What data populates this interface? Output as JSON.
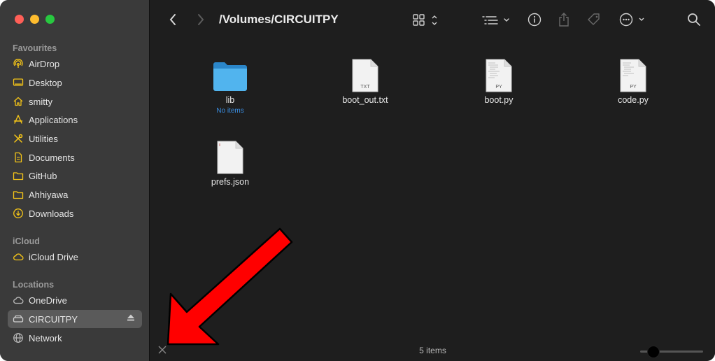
{
  "window": {
    "path_title": "/Volumes/CIRCUITPY"
  },
  "sidebar": {
    "favourites_heading": "Favourites",
    "favourites": [
      {
        "label": "AirDrop",
        "icon": "airdrop-icon"
      },
      {
        "label": "Desktop",
        "icon": "desktop-icon"
      },
      {
        "label": "smitty",
        "icon": "home-icon"
      },
      {
        "label": "Applications",
        "icon": "applications-icon"
      },
      {
        "label": "Utilities",
        "icon": "utilities-icon"
      },
      {
        "label": "Documents",
        "icon": "folder-icon"
      },
      {
        "label": "GitHub",
        "icon": "folder-icon"
      },
      {
        "label": "Ahhiyawa",
        "icon": "folder-icon"
      },
      {
        "label": "Downloads",
        "icon": "downloads-icon"
      }
    ],
    "icloud_heading": "iCloud",
    "icloud": [
      {
        "label": "iCloud Drive",
        "icon": "cloud-icon"
      }
    ],
    "locations_heading": "Locations",
    "locations": [
      {
        "label": "OneDrive",
        "icon": "cloud-icon"
      },
      {
        "label": "CIRCUITPY",
        "icon": "drive-icon",
        "selected": true
      },
      {
        "label": "Network",
        "icon": "network-icon"
      }
    ],
    "accent_color": "#f5c518"
  },
  "files": [
    {
      "name": "lib",
      "sub": "No items",
      "kind": "folder"
    },
    {
      "name": "boot_out.txt",
      "badge": "TXT",
      "kind": "document"
    },
    {
      "name": "boot.py",
      "badge": "PY",
      "kind": "document"
    },
    {
      "name": "code.py",
      "badge": "PY",
      "kind": "document"
    },
    {
      "name": "prefs.json",
      "badge": "",
      "kind": "document"
    }
  ],
  "status": {
    "items_text": "5 items",
    "zoom_fraction": 0.2
  },
  "annotation": {
    "arrow_color": "#ff0000"
  }
}
